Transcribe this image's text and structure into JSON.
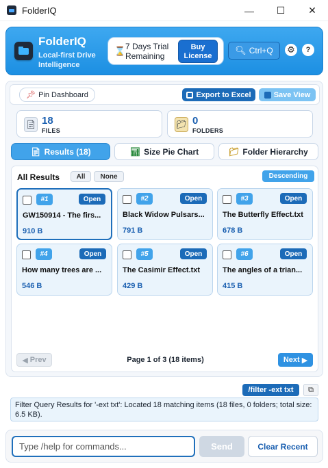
{
  "window": {
    "title": "FolderIQ",
    "minimize_glyph": "—",
    "maximize_glyph": "☐",
    "close_glyph": "✕"
  },
  "header": {
    "brand_title": "FolderIQ",
    "brand_subtitle": "Local-first Drive Intelligence",
    "trial_text": "7 Days Trial Remaining",
    "buy_label": "Buy License",
    "search_shortcut": "Ctrl+Q",
    "help_label": "?"
  },
  "toolbar": {
    "pin_label": "Pin Dashboard",
    "export_label": "Export to Excel",
    "save_view_label": "Save View"
  },
  "stats": {
    "files_count": "18",
    "files_label": "FILES",
    "folders_count": "0",
    "folders_label": "FOLDERS"
  },
  "tabs": {
    "results": "Results (18)",
    "pie": "Size Pie Chart",
    "hierarchy": "Folder Hierarchy"
  },
  "results": {
    "title": "All Results",
    "select_all": "All",
    "select_none": "None",
    "sort_label": "Descending",
    "open_label": "Open",
    "items": [
      {
        "num": "#1",
        "name": "GW150914 - The firs...",
        "size": "910 B"
      },
      {
        "num": "#2",
        "name": "Black Widow Pulsars...",
        "size": "791 B"
      },
      {
        "num": "#3",
        "name": "The Butterfly Effect.txt",
        "size": "678 B"
      },
      {
        "num": "#4",
        "name": "How many trees are ...",
        "size": "546 B"
      },
      {
        "num": "#5",
        "name": "The Casimir Effect.txt",
        "size": "429 B"
      },
      {
        "num": "#6",
        "name": "The angles of a trian...",
        "size": "415 B"
      }
    ],
    "prev_label": "Prev",
    "next_label": "Next",
    "page_info": "Page 1 of 3 (18 items)"
  },
  "command": {
    "last_command": "/filter -ext txt",
    "response": "Filter Query Results for '-ext txt': Located 18 matching items (18 files, 0 folders; total size: 6.5 KB).",
    "input_placeholder": "Type /help for commands...",
    "send_label": "Send",
    "clear_label": "Clear Recent"
  },
  "colors": {
    "accent": "#41a3ea",
    "primary": "#1c6bb8",
    "header_bg": "#2b9ae8"
  }
}
